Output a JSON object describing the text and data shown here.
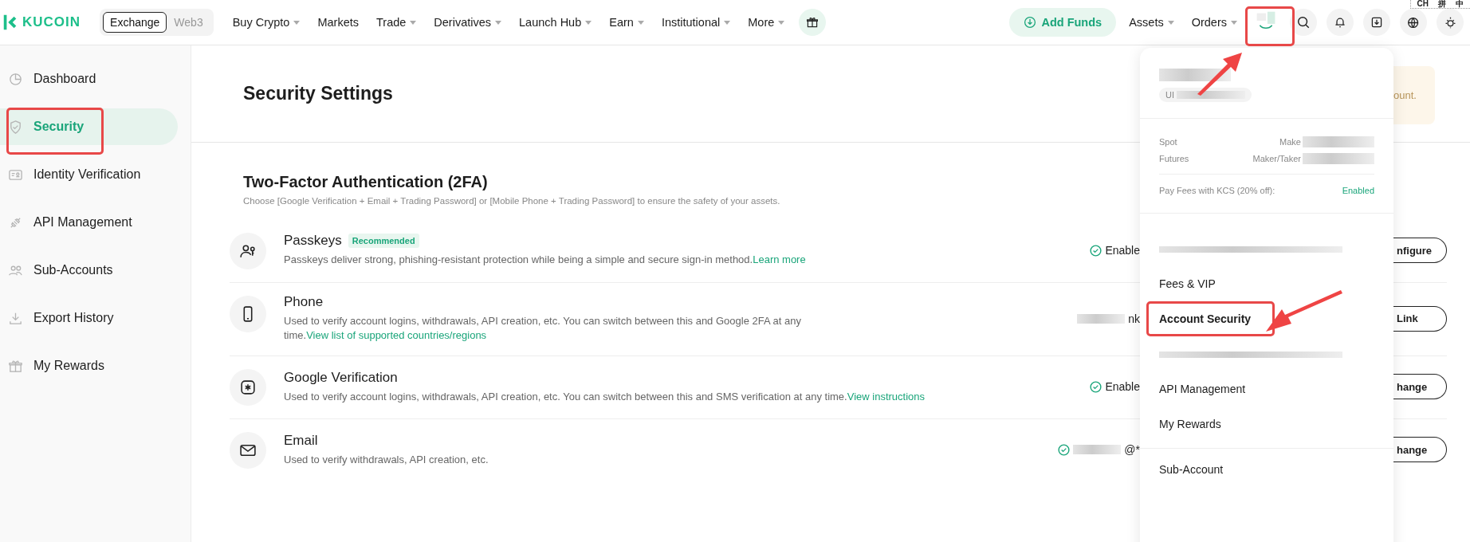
{
  "nav": {
    "brand": "KUCOIN",
    "modes": [
      {
        "label": "Exchange",
        "selected": true
      },
      {
        "label": "Web3",
        "selected": false
      }
    ],
    "items": [
      {
        "label": "Buy Crypto",
        "has_menu": true
      },
      {
        "label": "Markets",
        "has_menu": false
      },
      {
        "label": "Trade",
        "has_menu": true
      },
      {
        "label": "Derivatives",
        "has_menu": true
      },
      {
        "label": "Launch Hub",
        "has_menu": true
      },
      {
        "label": "Earn",
        "has_menu": true
      },
      {
        "label": "Institutional",
        "has_menu": true
      },
      {
        "label": "More",
        "has_menu": true
      }
    ],
    "add_funds": "Add Funds",
    "right_items": [
      {
        "label": "Assets",
        "has_menu": true
      },
      {
        "label": "Orders",
        "has_menu": true
      }
    ],
    "ime": [
      "CH",
      "拼",
      "中"
    ]
  },
  "sidebar": {
    "items": [
      {
        "label": "Dashboard",
        "selected": false
      },
      {
        "label": "Security",
        "selected": true
      },
      {
        "label": "Identity Verification",
        "selected": false
      },
      {
        "label": "API Management",
        "selected": false
      },
      {
        "label": "Sub-Accounts",
        "selected": false
      },
      {
        "label": "Export History",
        "selected": false
      },
      {
        "label": "My Rewards",
        "selected": false
      }
    ]
  },
  "page_title": "Security Settings",
  "notice_fragment": "ount.",
  "section": {
    "title": "Two-Factor Authentication (2FA)",
    "subtitle": "Choose [Google Verification + Email + Trading Password] or [Mobile Phone + Trading Password] to ensure the safety of your assets.",
    "rows": [
      {
        "title": "Passkeys",
        "badge": "Recommended",
        "description": "Passkeys deliver strong, phishing-resistant protection while being a simple and secure sign-in method.",
        "link": "Learn more",
        "status": {
          "kind": "enabled",
          "text": "Enable"
        },
        "button": "nfigure"
      },
      {
        "title": "Phone",
        "description": "Used to verify account logins, withdrawals, API creation, etc. You can switch between this and Google 2FA at any time.",
        "link": "View list of supported countries/regions",
        "status": {
          "kind": "redacted",
          "text": "nk"
        },
        "button": "Link"
      },
      {
        "title": "Google Verification",
        "description": "Used to verify account logins, withdrawals, API creation, etc. You can switch between this and SMS verification at any time.",
        "link": "View instructions",
        "status": {
          "kind": "enabled",
          "text": "Enable"
        },
        "button": "hange"
      },
      {
        "title": "Email",
        "description": "Used to verify withdrawals, API creation, etc.",
        "status": {
          "kind": "enabled_redacted",
          "text": "@*"
        },
        "button": "hange"
      }
    ]
  },
  "menu": {
    "uid_prefix": "UI",
    "fees": [
      {
        "label": "Spot",
        "value": "Make"
      },
      {
        "label": "Futures",
        "value": "Maker/Taker"
      }
    ],
    "kcs": {
      "label": "Pay Fees with KCS (20% off):",
      "value": "Enabled"
    },
    "items": [
      {
        "kind": "redacted"
      },
      {
        "kind": "link",
        "label": "Fees & VIP",
        "selected": false
      },
      {
        "kind": "link",
        "label": "Account Security",
        "selected": true
      },
      {
        "kind": "redacted"
      },
      {
        "kind": "link",
        "label": "API Management",
        "selected": false
      },
      {
        "kind": "link",
        "label": "My Rewards",
        "selected": false
      },
      {
        "kind": "divider"
      },
      {
        "kind": "link",
        "label": "Sub-Account",
        "selected": false
      }
    ]
  }
}
